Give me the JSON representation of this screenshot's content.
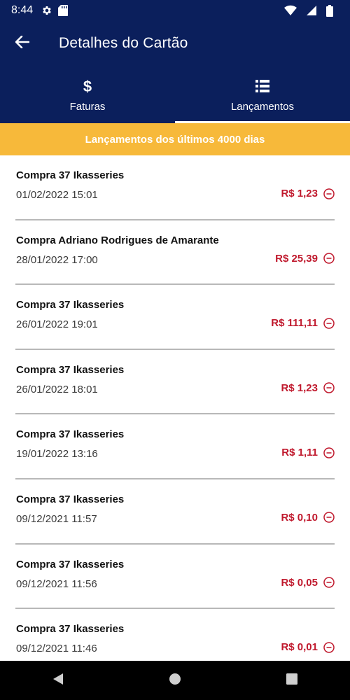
{
  "status_bar": {
    "time": "8:44",
    "icons": [
      "settings-icon",
      "sd-card-icon",
      "wifi-icon",
      "signal-icon",
      "battery-icon"
    ]
  },
  "app_bar": {
    "title": "Detalhes do Cartão",
    "back_icon": "arrow-left-icon"
  },
  "tabs": [
    {
      "label": "Faturas",
      "icon": "dollar-icon",
      "active": false
    },
    {
      "label": "Lançamentos",
      "icon": "list-icon",
      "active": true
    }
  ],
  "banner": {
    "text": "Lançamentos dos últimos 4000 dias"
  },
  "transactions": [
    {
      "description": "Compra 37 Ikasseries",
      "datetime": "01/02/2022 15:01",
      "amount": "R$ 1,23"
    },
    {
      "description": "Compra Adriano Rodrigues de  Amarante",
      "datetime": "28/01/2022 17:00",
      "amount": "R$ 25,39"
    },
    {
      "description": "Compra 37 Ikasseries",
      "datetime": "26/01/2022 19:01",
      "amount": "R$ 111,11"
    },
    {
      "description": "Compra 37 Ikasseries",
      "datetime": "26/01/2022 18:01",
      "amount": "R$ 1,23"
    },
    {
      "description": "Compra 37 Ikasseries",
      "datetime": "19/01/2022 13:16",
      "amount": "R$ 1,11"
    },
    {
      "description": "Compra 37 Ikasseries",
      "datetime": "09/12/2021 11:57",
      "amount": "R$ 0,10"
    },
    {
      "description": "Compra 37 Ikasseries",
      "datetime": "09/12/2021 11:56",
      "amount": "R$ 0,05"
    },
    {
      "description": "Compra 37 Ikasseries",
      "datetime": "09/12/2021 11:46",
      "amount": "R$ 0,01"
    }
  ],
  "colors": {
    "primary": "#0b1f5c",
    "banner": "#f7b93a",
    "debit": "#c0192d"
  },
  "nav_bar": [
    "back-triangle-icon",
    "home-circle-icon",
    "recents-square-icon"
  ]
}
